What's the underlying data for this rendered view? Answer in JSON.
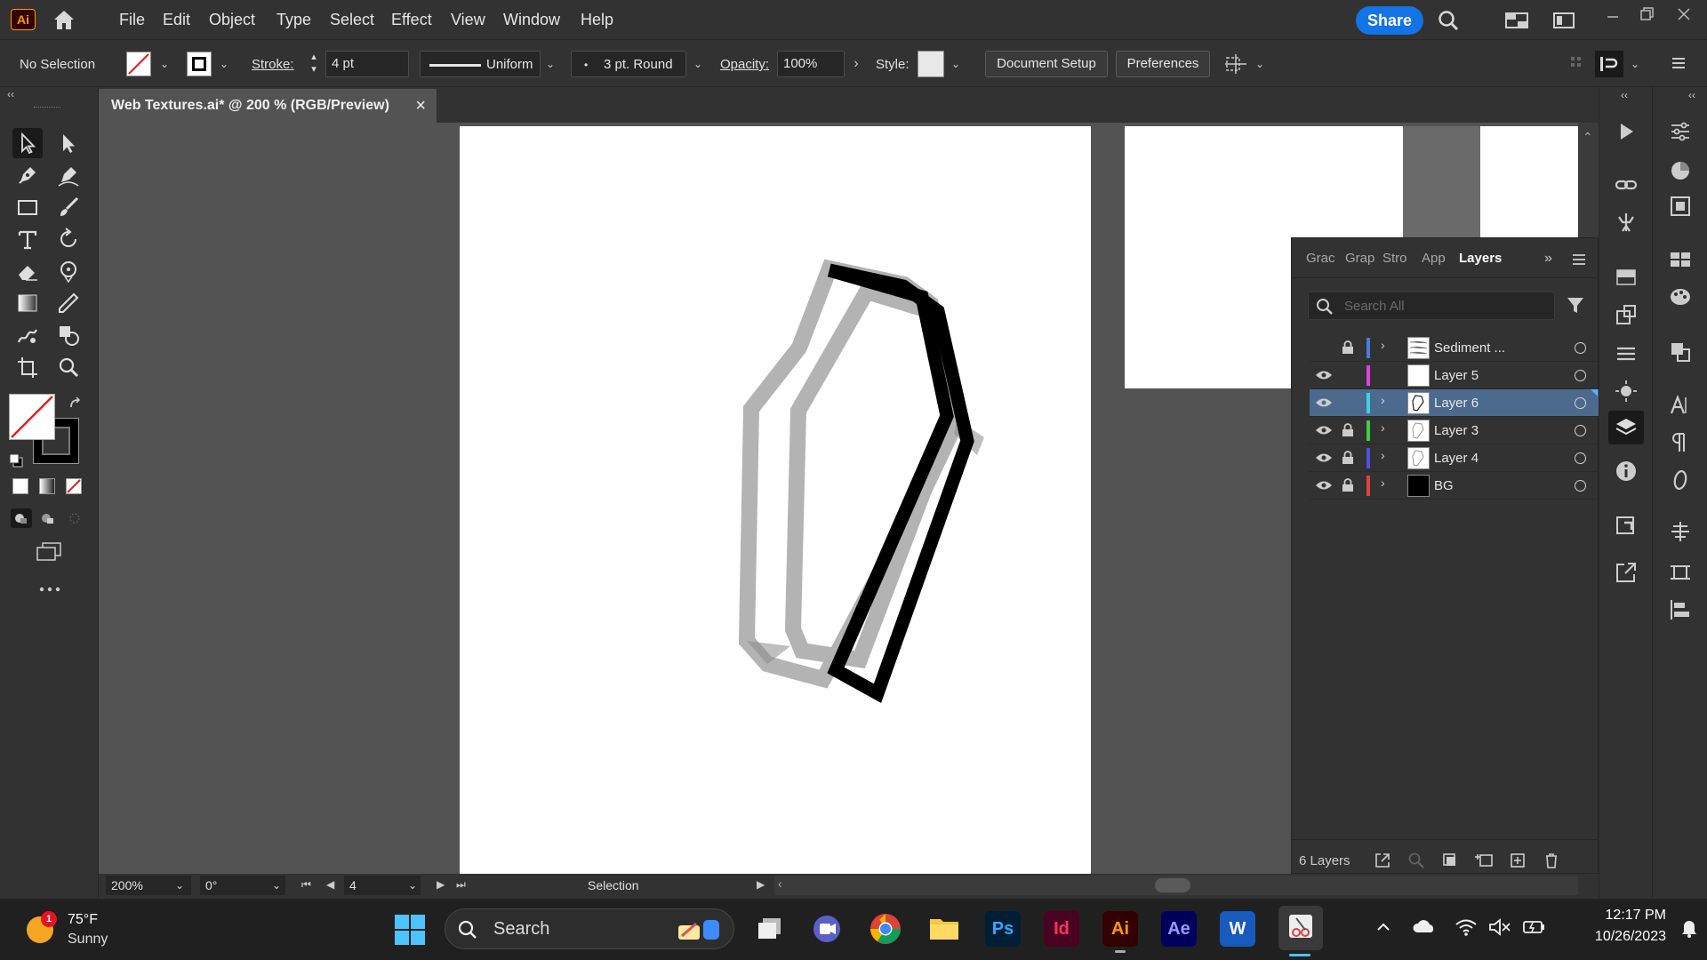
{
  "app": {
    "logo": "Ai",
    "menu": [
      "File",
      "Edit",
      "Object",
      "Type",
      "Select",
      "Effect",
      "View",
      "Window",
      "Help"
    ],
    "share_label": "Share"
  },
  "control": {
    "selection_label": "No Selection",
    "stroke_label": "Stroke:",
    "stroke_value": "4 pt",
    "profile_label": "Uniform",
    "brush_label": "3 pt. Round",
    "opacity_label": "Opacity:",
    "opacity_value": "100%",
    "style_label": "Style:",
    "document_setup": "Document Setup",
    "preferences": "Preferences"
  },
  "document": {
    "tab_title": "Web Textures.ai* @ 200 % (RGB/Preview)",
    "close_glyph": "×"
  },
  "status": {
    "zoom": "200%",
    "rotation": "0°",
    "artboard_num": "4",
    "tool_name": "Selection"
  },
  "layers_panel": {
    "tabs": [
      "Grac",
      "Grap",
      "Stro",
      "App",
      "Layers"
    ],
    "active_tab": "Layers",
    "search_placeholder": "Search All",
    "layers": [
      {
        "name": "Sediment ...",
        "color": "#4a7be0",
        "visible": false,
        "locked": true,
        "expandable": true,
        "thumb": "texture"
      },
      {
        "name": "Layer 5",
        "color": "#e040e0",
        "visible": true,
        "locked": false,
        "expandable": false,
        "thumb": "blank"
      },
      {
        "name": "Layer 6",
        "color": "#40d0e0",
        "visible": true,
        "locked": false,
        "expandable": true,
        "thumb": "shape",
        "selected": true
      },
      {
        "name": "Layer 3",
        "color": "#40d040",
        "visible": true,
        "locked": true,
        "expandable": true,
        "thumb": "shape"
      },
      {
        "name": "Layer 4",
        "color": "#5050e0",
        "visible": true,
        "locked": true,
        "expandable": true,
        "thumb": "shape"
      },
      {
        "name": "BG",
        "color": "#e04040",
        "visible": true,
        "locked": true,
        "expandable": true,
        "thumb": "black"
      }
    ],
    "count_label": "6 Layers"
  },
  "taskbar": {
    "weather_temp": "75°F",
    "weather_cond": "Sunny",
    "weather_badge": "1",
    "search_label": "Search",
    "apps": [
      {
        "label": "Ps",
        "color": "#31a8ff",
        "bg": "#001e36"
      },
      {
        "label": "Id",
        "color": "#ff3366",
        "bg": "#49021f"
      },
      {
        "label": "Ai",
        "color": "#ff9a00",
        "bg": "#330000"
      },
      {
        "label": "Ae",
        "color": "#9999ff",
        "bg": "#00005b"
      },
      {
        "label": "W",
        "color": "#ffffff",
        "bg": "#185abd"
      }
    ],
    "time": "12:17 PM",
    "date": "10/26/2023"
  }
}
